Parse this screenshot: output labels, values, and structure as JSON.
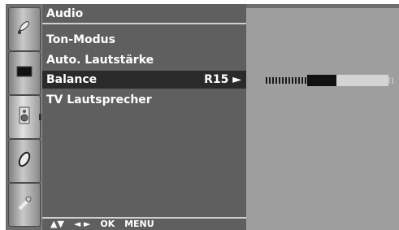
{
  "menu": {
    "title": "Audio",
    "items": [
      {
        "label": "Ton-Modus"
      },
      {
        "label": "Auto. Lautstärke"
      },
      {
        "label": "Balance",
        "value": "R15 ►"
      },
      {
        "label": "TV Lautsprecher"
      }
    ],
    "selected_index": 2
  },
  "rail": {
    "icons": [
      "satellite-dish-icon",
      "screen-icon",
      "speaker-icon",
      "disc-icon",
      "wrench-icon"
    ],
    "active_icon": "speaker-icon"
  },
  "footer": {
    "up_down": "▲▼",
    "left_right": "◄ ►",
    "ok": "OK",
    "menu": "MENU"
  },
  "balance": {
    "value": 15,
    "side": "R"
  }
}
